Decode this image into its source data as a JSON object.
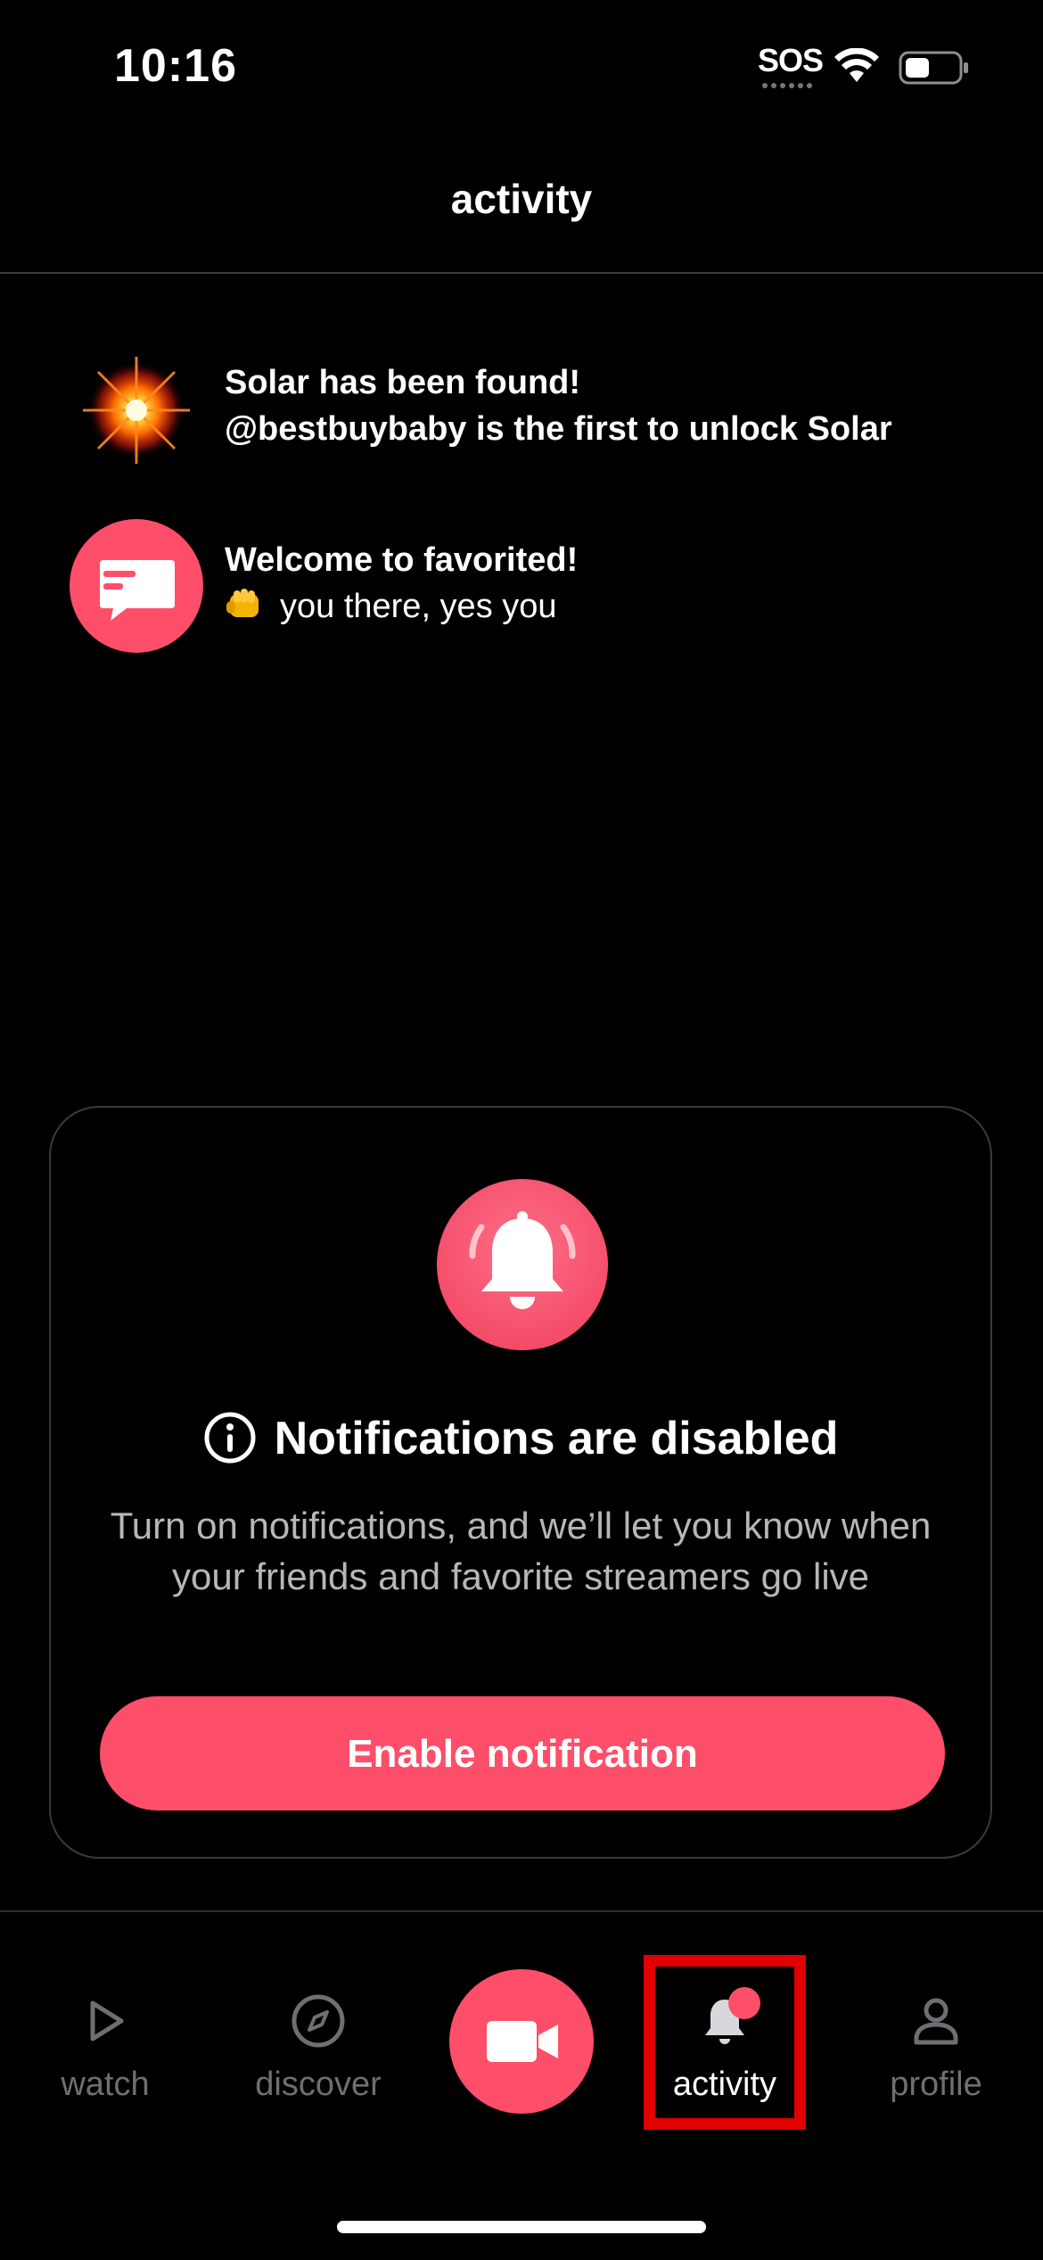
{
  "status_bar": {
    "time": "10:16",
    "sos": "SOS",
    "wifi_icon": "wifi-icon",
    "battery_icon": "battery-icon"
  },
  "header": {
    "title": "activity"
  },
  "activity": [
    {
      "icon": "solar-star-icon",
      "title": "Solar has been found!",
      "subtitle": "@bestbuybaby is the first to unlock Solar"
    },
    {
      "icon": "chat-bubble-icon",
      "title": "Welcome to favorited!",
      "emoji": "fist-bump-emoji",
      "subtitle": "you there, yes you"
    }
  ],
  "notifications_card": {
    "icon": "bell-icon",
    "heading": "Notifications are disabled",
    "body": "Turn on notifications, and we’ll let you know when your friends and favorite streamers go live",
    "button_label": "Enable notification"
  },
  "tab_bar": {
    "tabs": [
      {
        "label": "watch",
        "icon": "play-icon",
        "active": false
      },
      {
        "label": "discover",
        "icon": "compass-icon",
        "active": false
      },
      {
        "label": "",
        "icon": "video-camera-icon",
        "active": false
      },
      {
        "label": "activity",
        "icon": "bell-icon",
        "active": true,
        "badge": true
      },
      {
        "label": "profile",
        "icon": "person-icon",
        "active": false
      }
    ]
  },
  "colors": {
    "accent": "#fe4e69",
    "background": "#000000",
    "muted_text": "#6e6e73",
    "highlight_box": "#e00000"
  }
}
